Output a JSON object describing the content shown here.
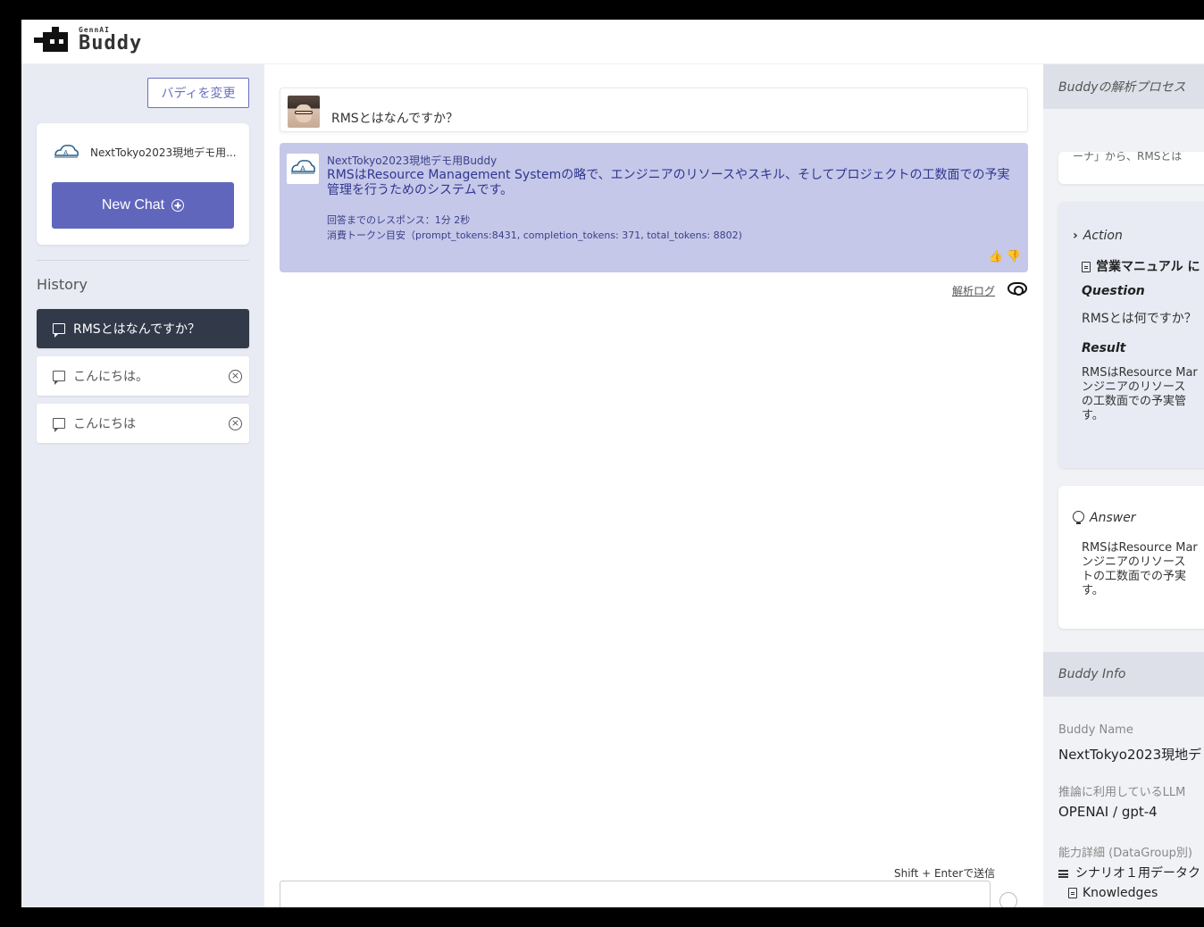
{
  "app": {
    "logo_small": "GennAI",
    "logo_big": "Buddy"
  },
  "sidebar": {
    "change_buddy_label": "バディを変更",
    "buddy_name": "NextTokyo2023現地デモ用...",
    "new_chat_label": "New Chat",
    "history_title": "History",
    "history_items": [
      {
        "label": "RMSとはなんですか？",
        "active": true
      },
      {
        "label": "こんにちは。",
        "active": false
      },
      {
        "label": "こんにちは",
        "active": false
      }
    ]
  },
  "chat": {
    "user_message": "RMSとはなんですか？",
    "bot_name": "NextTokyo2023現地デモ用Buddy",
    "bot_message": "RMSはResource Management Systemの略で、エンジニアのリソースやスキル、そしてプロジェクトの工数面での予実管理を行うためのシステムです。",
    "response_time": "回答までのレスポンス：1分 2秒",
    "token_usage": "消費トークン目安（prompt_tokens:8431, completion_tokens: 371, total_tokens: 8802)",
    "analysis_log_label": "解析ログ",
    "send_hint": "Shift + Enterで送信",
    "input_placeholder": ""
  },
  "right_panel": {
    "process_title": "Buddyの解析プロセス",
    "top_card_fragment": "ーナ」から、RMSとは",
    "action_label": "Action",
    "action_doc": "営業マニュアル に",
    "question_label": "Question",
    "question_text": "RMSとは何ですか？",
    "result_label": "Result",
    "result_text_lines": [
      "RMSはResource Mar",
      "ンジニアのリソース",
      "の工数面での予実管",
      "す。"
    ],
    "answer_label": "Answer",
    "answer_text_lines": [
      "RMSはResource Mar",
      "ンジニアのリソース",
      "トの工数面での予実",
      "す。"
    ],
    "info_title": "Buddy Info",
    "buddy_name_label": "Buddy Name",
    "buddy_name_value": "NextTokyo2023現地デ",
    "llm_label": "推論に利用しているLLM",
    "llm_value": "OPENAI / gpt-4",
    "ability_label": "能力詳細 (DataGroup別)",
    "ability_group": "シナリオ１用データク",
    "ability_sub": "Knowledges"
  },
  "colors": {
    "accent": "#6166bd",
    "bot_bubble": "#c5c8e8",
    "active_history": "#323a4a",
    "sidebar_bg": "#e8ebf3"
  }
}
